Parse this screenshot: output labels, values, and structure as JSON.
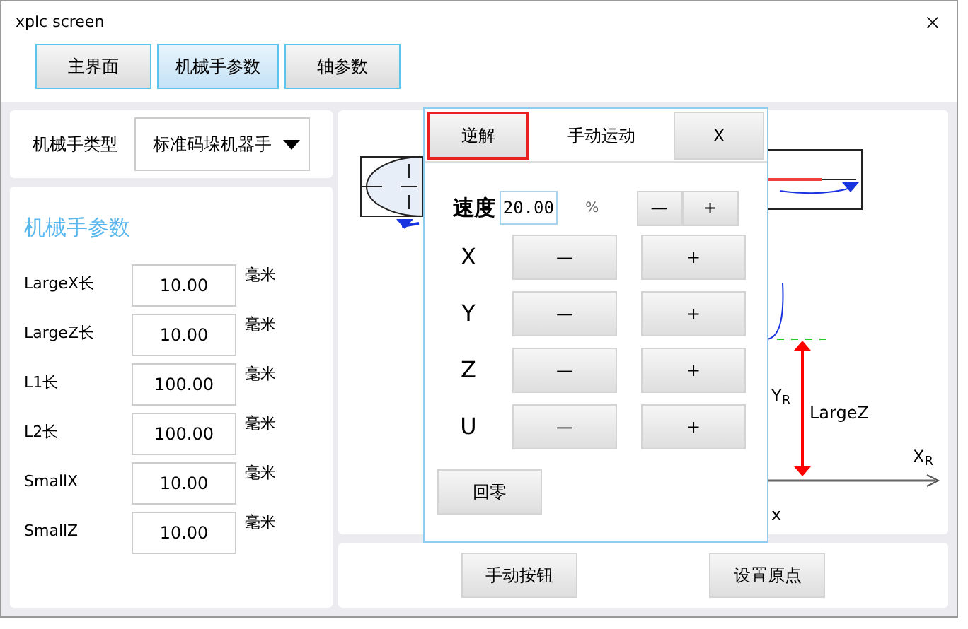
{
  "window": {
    "title": "xplc screen"
  },
  "tabs": [
    {
      "label": "主界面",
      "selected": false
    },
    {
      "label": "机械手参数",
      "selected": true
    },
    {
      "label": "轴参数",
      "selected": false
    }
  ],
  "robot_type": {
    "label": "机械手类型",
    "value": "标准码垛机器手"
  },
  "params": {
    "title": "机械手参数",
    "rows": [
      {
        "label": "LargeX长",
        "value": "10.00",
        "unit": "毫米"
      },
      {
        "label": "LargeZ长",
        "value": "10.00",
        "unit": "毫米"
      },
      {
        "label": "L1长",
        "value": "100.00",
        "unit": "毫米"
      },
      {
        "label": "L2长",
        "value": "100.00",
        "unit": "毫米"
      },
      {
        "label": "SmallX",
        "value": "10.00",
        "unit": "毫米"
      },
      {
        "label": "SmallZ",
        "value": "10.00",
        "unit": "毫米"
      }
    ]
  },
  "diagram": {
    "labels": [
      "Y$_{R}$",
      "LargeZ",
      "X$_{R}$",
      "x"
    ]
  },
  "bottom_buttons": [
    "手动按钮",
    "设置原点"
  ],
  "dialog": {
    "left_button": {
      "label": "逆解",
      "highlighted": true
    },
    "title": "手动运动",
    "close": "X",
    "speed": {
      "label": "速度",
      "value": "20.00",
      "unit": "%",
      "minus": "—",
      "plus": "+"
    },
    "axes": [
      {
        "label": "X",
        "minus": "—",
        "plus": "+"
      },
      {
        "label": "Y",
        "minus": "—",
        "plus": "+"
      },
      {
        "label": "Z",
        "minus": "—",
        "plus": "+"
      },
      {
        "label": "U",
        "minus": "—",
        "plus": "+"
      }
    ],
    "home_button": "回零"
  }
}
